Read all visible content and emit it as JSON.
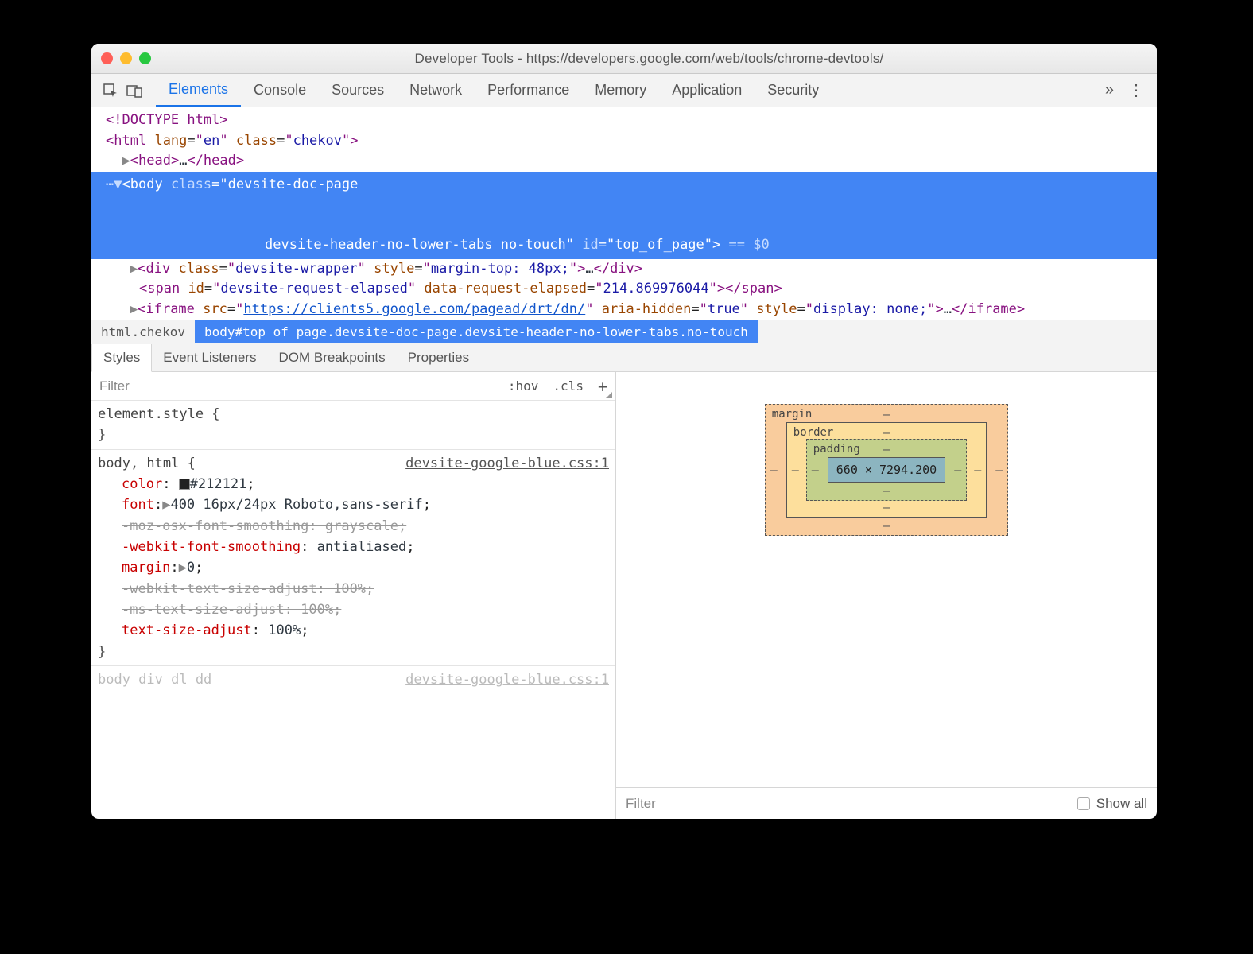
{
  "titlebar": "Developer Tools - https://developers.google.com/web/tools/chrome-devtools/",
  "tabs": [
    "Elements",
    "Console",
    "Sources",
    "Network",
    "Performance",
    "Memory",
    "Application",
    "Security"
  ],
  "dom": {
    "doctype": "<!DOCTYPE html>",
    "html_tag": "html",
    "html_lang": "en",
    "html_class": "chekov",
    "head": "head",
    "body_tag": "body",
    "body_class_line1": "devsite-doc-page",
    "body_class_line2": "devsite-header-no-lower-tabs no-touch",
    "body_id": "top_of_page",
    "body_eq": " == $0",
    "div_class": "devsite-wrapper",
    "div_style": "margin-top: 48px;",
    "span_id": "devsite-request-elapsed",
    "span_attr": "data-request-elapsed",
    "span_attr_val": "214.869976044",
    "iframe_src": "https://clients5.google.com/pagead/drt/dn/",
    "iframe_aria": "true",
    "iframe_style": "display: none;"
  },
  "breadcrumb": {
    "c1": "html.chekov",
    "c2": "body#top_of_page.devsite-doc-page.devsite-header-no-lower-tabs.no-touch"
  },
  "subtabs": [
    "Styles",
    "Event Listeners",
    "DOM Breakpoints",
    "Properties"
  ],
  "styles": {
    "filter": "Filter",
    "hov": ":hov",
    "cls": ".cls",
    "element_style": "element.style {",
    "rule_selector": "body, html {",
    "rule_source": "devsite-google-blue.css:1",
    "p_color": "color",
    "v_color": "#212121",
    "p_font": "font",
    "v_font": "400 16px/24px Roboto,sans-serif",
    "p_moz": "-moz-osx-font-smoothing: grayscale;",
    "p_wfs": "-webkit-font-smoothing",
    "v_wfs": "antialiased",
    "p_margin": "margin",
    "v_margin": "0",
    "p_wtsa": "-webkit-text-size-adjust: 100%;",
    "p_mtsa": "-ms-text-size-adjust: 100%;",
    "p_tsa": "text-size-adjust",
    "v_tsa": "100%",
    "next_sel": "body  div  dl  dd",
    "next_src": "devsite-google-blue.css:1"
  },
  "box": {
    "margin": "margin",
    "border": "border",
    "padding": "padding",
    "content": "660 × 7294.200",
    "dash": "–"
  },
  "computed": {
    "filter": "Filter",
    "showall": "Show all"
  }
}
